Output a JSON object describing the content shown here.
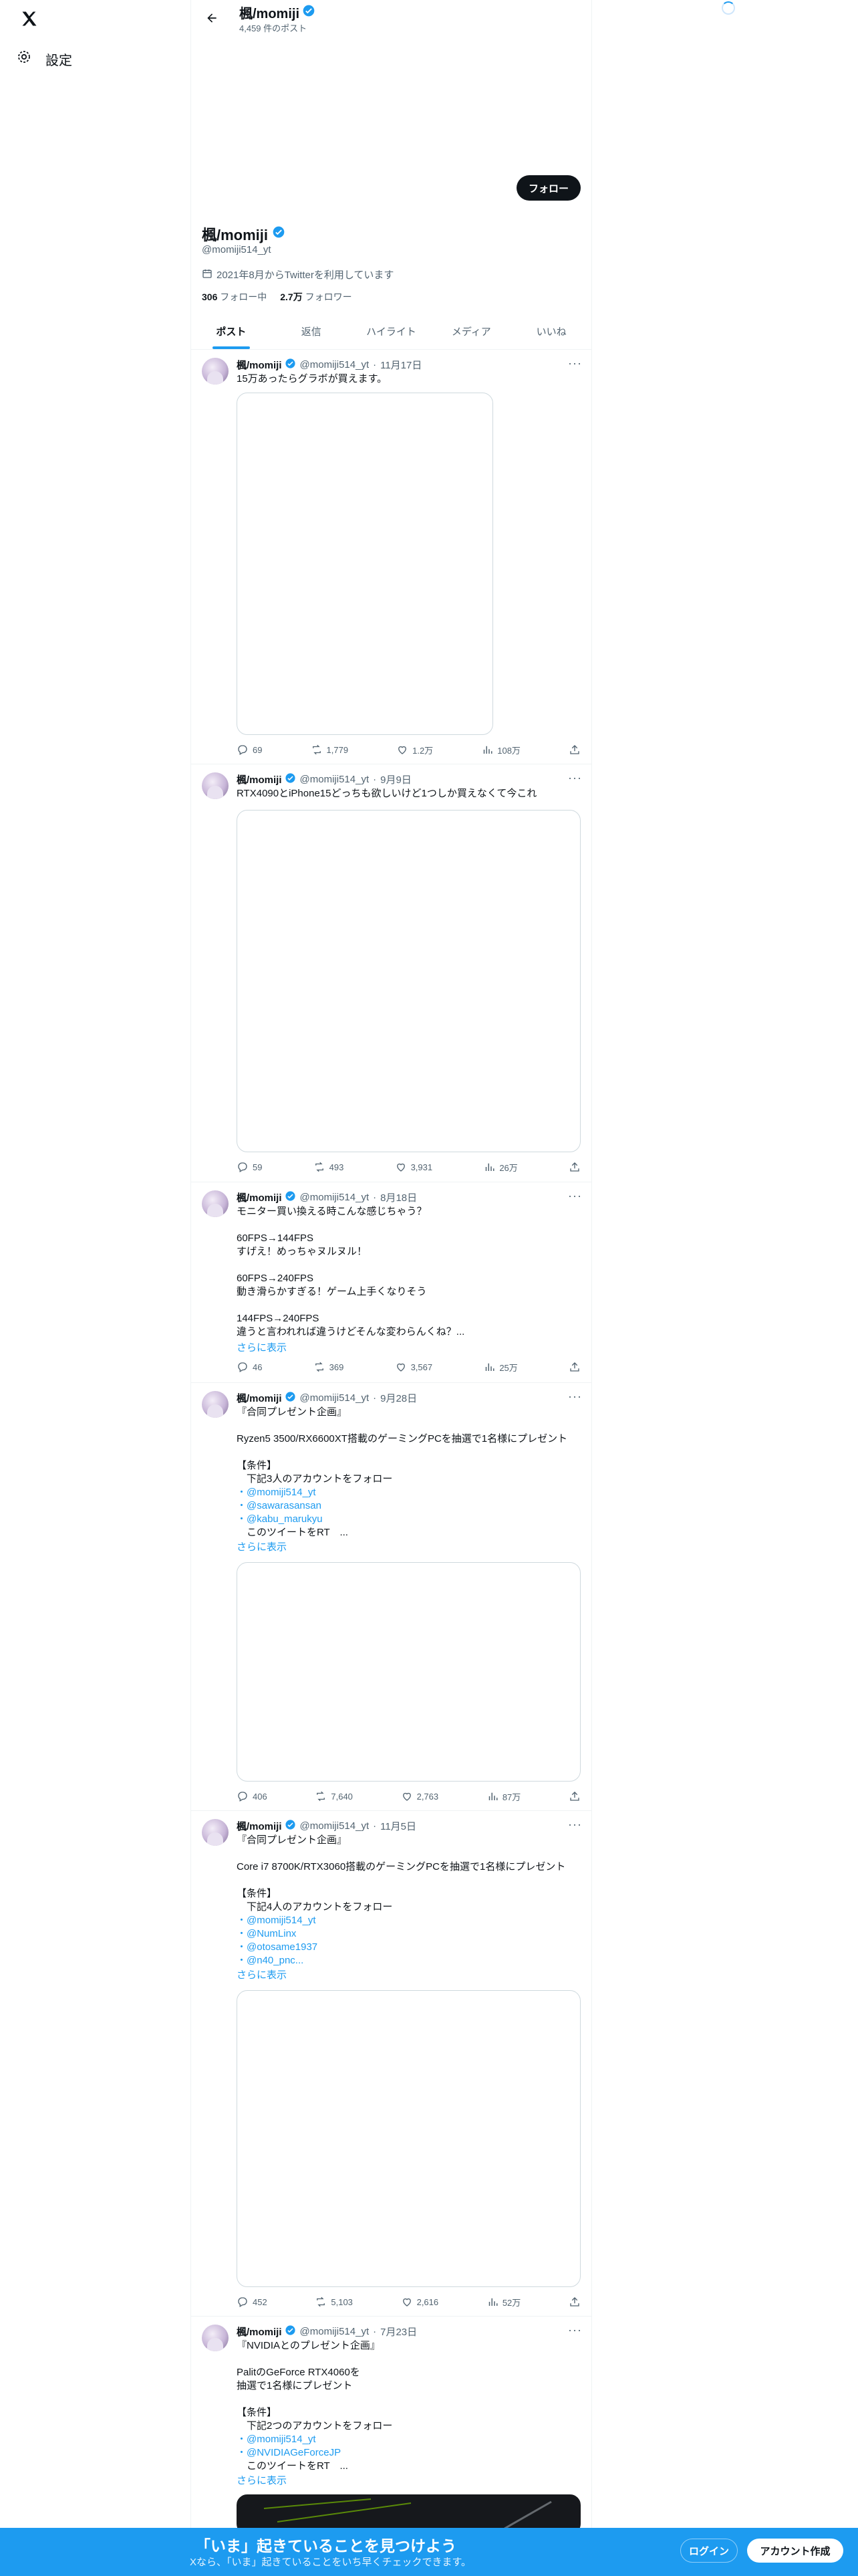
{
  "nav": {
    "settings_label": "設定"
  },
  "header": {
    "name": "楓/momiji",
    "post_count": "4,459 件のポスト"
  },
  "profile": {
    "name": "楓/momiji",
    "handle": "@momiji514_yt",
    "joined": "2021年8月からTwitterを利用しています",
    "following_count": "306",
    "following_label": "フォロー中",
    "followers_count": "2.7万",
    "followers_label": "フォロワー",
    "follow_button": "フォロー"
  },
  "tabs": [
    {
      "label": "ポスト"
    },
    {
      "label": "返信"
    },
    {
      "label": "ハイライト"
    },
    {
      "label": "メディア"
    },
    {
      "label": "いいね"
    }
  ],
  "posts": [
    {
      "name": "楓/momiji",
      "handle": "@momiji514_yt",
      "date": "11月17日",
      "text": "15万あったらグラボが買えます。",
      "replies": "69",
      "reposts": "1,779",
      "likes": "1.2万",
      "views": "108万"
    },
    {
      "name": "楓/momiji",
      "handle": "@momiji514_yt",
      "date": "9月9日",
      "text": "RTX4090とiPhone15どっちも欲しいけど1つしか買えなくて今これ",
      "replies": "59",
      "reposts": "493",
      "likes": "3,931",
      "views": "26万"
    },
    {
      "name": "楓/momiji",
      "handle": "@momiji514_yt",
      "date": "8月18日",
      "text": "モニター買い換える時こんな感じちゃう？\n\n60FPS→144FPS\nすげえ！めっちゃヌルヌル！\n\n60FPS→240FPS\n動き滑らかすぎる！ゲーム上手くなりそう\n\n144FPS→240FPS\n違うと言われれば違うけどそんな変わらんくね？...",
      "show_more": "さらに表示",
      "replies": "46",
      "reposts": "369",
      "likes": "3,567",
      "views": "25万"
    },
    {
      "name": "楓/momiji",
      "handle": "@momiji514_yt",
      "date": "9月28日",
      "text_lines": [
        "『合同プレゼント企画』",
        "",
        "Ryzen5 3500/RX6600XT搭載のゲーミングPCを抽選で1名様にプレゼント",
        "",
        "【条件】",
        "　下記3人のアカウントをフォロー",
        "・@momiji514_yt",
        "・@sawarasansan",
        "・@kabu_marukyu",
        "　このツイートをRT　..."
      ],
      "show_more": "さらに表示",
      "replies": "406",
      "reposts": "7,640",
      "likes": "2,763",
      "views": "87万"
    },
    {
      "name": "楓/momiji",
      "handle": "@momiji514_yt",
      "date": "11月5日",
      "text_lines": [
        "『合同プレゼント企画』",
        "",
        "Core i7 8700K/RTX3060搭載のゲーミングPCを抽選で1名様にプレゼント",
        "",
        "【条件】",
        "　下記4人のアカウントをフォロー",
        "・@momiji514_yt",
        "・@NumLinx",
        "・@otosame1937",
        "・@n40_pnc..."
      ],
      "show_more": "さらに表示",
      "replies": "452",
      "reposts": "5,103",
      "likes": "2,616",
      "views": "52万"
    },
    {
      "name": "楓/momiji",
      "handle": "@momiji514_yt",
      "date": "7月23日",
      "text_lines": [
        "『NVIDIAとのプレゼント企画』",
        "",
        "PalitのGeForce RTX4060を",
        "抽選で1名様にプレゼント",
        "",
        "【条件】",
        "　下記2つのアカウントをフォロー",
        "・@momiji514_yt",
        "・@NVIDIAGeForceJP",
        "　このツイートをRT　..."
      ],
      "show_more": "さらに表示"
    }
  ],
  "bottom_bar": {
    "title": "「いま」起きていることを見つけよう",
    "subtitle": "Xなら、「いま」起きていることをいち早くチェックできます。",
    "login": "ログイン",
    "signup": "アカウント作成"
  },
  "colors": {
    "accent": "#1d9bf0",
    "text": "#0f1419",
    "muted": "#536471",
    "border": "#eff3f4"
  }
}
